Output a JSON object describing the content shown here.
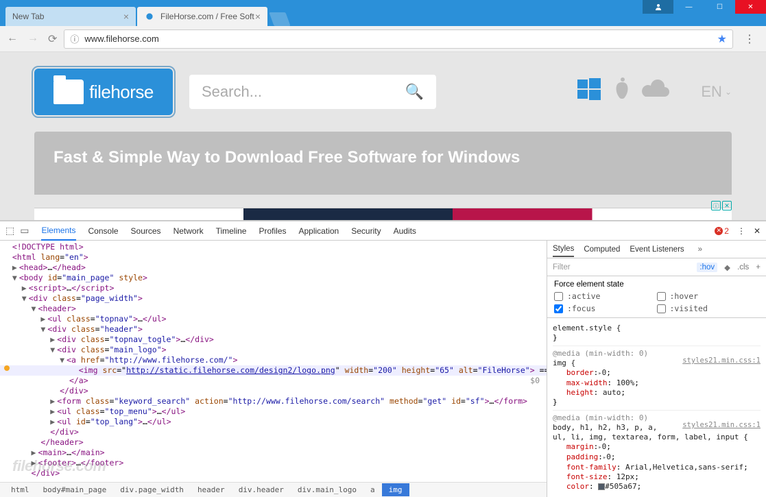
{
  "window": {
    "tabs": [
      {
        "title": "New Tab",
        "active": false
      },
      {
        "title": "FileHorse.com / Free Soft",
        "active": true
      }
    ],
    "address": "www.filehorse.com"
  },
  "page": {
    "logo_text": "filehorse",
    "search_placeholder": "Search...",
    "lang": "EN",
    "hero_title": "Fast & Simple Way to Download Free Software for Windows"
  },
  "devtools": {
    "tabs": [
      "Elements",
      "Console",
      "Sources",
      "Network",
      "Timeline",
      "Profiles",
      "Application",
      "Security",
      "Audits"
    ],
    "active_tab": "Elements",
    "error_count": "2",
    "dom": {
      "l1": "<!DOCTYPE html>",
      "l2_open": "<html ",
      "l2_attr_n": "lang",
      "l2_attr_v": "\"en\"",
      "l2_close": ">",
      "l3": "<head>",
      "l3_ell": "…",
      "l3_end": "</head>",
      "l4_open": "<body ",
      "l4_a1n": "id",
      "l4_a1v": "\"main_page\"",
      "l4_a2n": "style",
      "l4_close": ">",
      "l5": "<script>",
      "l5_ell": "…",
      "l5_end": "</script>",
      "l6_open": "<div ",
      "l6_an": "class",
      "l6_av": "\"page_width\"",
      "l6_close": ">",
      "l7": "<header>",
      "l8_open": "<ul ",
      "l8_an": "class",
      "l8_av": "\"topnav\"",
      "l8_close": ">",
      "l8_ell": "…",
      "l8_end": "</ul>",
      "l9_open": "<div ",
      "l9_an": "class",
      "l9_av": "\"header\"",
      "l9_close": ">",
      "l10_open": "<div ",
      "l10_an": "class",
      "l10_av": "\"topnav_togle\"",
      "l10_close": ">",
      "l10_ell": "…",
      "l10_end": "</div>",
      "l11_open": "<div ",
      "l11_an": "class",
      "l11_av": "\"main_logo\"",
      "l11_close": ">",
      "l12_open": "<a ",
      "l12_an": "href",
      "l12_av": "\"http://www.filehorse.com/\"",
      "l12_close": ">",
      "l13_open": "<img ",
      "l13_a1n": "src",
      "l13_a1v": "http://static.filehorse.com/design2/logo.png",
      "l13_a2n": "width",
      "l13_a2v": "\"200\"",
      "l13_a3n": "height",
      "l13_a3v": "\"65\"",
      "l13_a4n": "alt",
      "l13_a4v": "\"FileHorse\"",
      "l13_close": ">",
      "l13_eq": " ==",
      "l13_dollar": "$0",
      "l14": "</a>",
      "l15": "</div>",
      "l16_open": "<form ",
      "l16_a1n": "class",
      "l16_a1v": "\"keyword_search\"",
      "l16_a2n": "action",
      "l16_a2v": "\"http://www.filehorse.com/search\"",
      "l16_a3n": "method",
      "l16_a3v": "\"get\"",
      "l16_a4n": "id",
      "l16_a4v": "\"sf\"",
      "l16_close": ">",
      "l16_ell": "…",
      "l16_end": "</form>",
      "l17_open": "<ul ",
      "l17_an": "class",
      "l17_av": "\"top_menu\"",
      "l17_close": ">",
      "l17_ell": "…",
      "l17_end": "</ul>",
      "l18_open": "<ul ",
      "l18_an": "id",
      "l18_av": "\"top_lang\"",
      "l18_close": ">",
      "l18_ell": "…",
      "l18_end": "</ul>",
      "l19": "</div>",
      "l20": "</header>",
      "l21": "<main>",
      "l21_ell": "…",
      "l21_end": "</main>",
      "l22": "<footer>",
      "l22_ell": "…",
      "l22_end": "</footer>",
      "l23": "</div>"
    },
    "breadcrumbs": [
      "html",
      "body#main_page",
      "div.page_width",
      "header",
      "div.header",
      "div.main_logo",
      "a",
      "img"
    ],
    "styles": {
      "tabs": [
        "Styles",
        "Computed",
        "Event Listeners"
      ],
      "filter_placeholder": "Filter",
      "hov": ":hov",
      "cls": ".cls",
      "force_label": "Force element state",
      "states": {
        "active": ":active",
        "hover": ":hover",
        "focus": ":focus",
        "visited": ":visited"
      },
      "rule1_sel": "element.style {",
      "rule1_close": "}",
      "rule2_media": "@media (min-width: 0)",
      "rule2_sel": "img {",
      "rule2_src": "styles21.min.css:1",
      "rule2_p1": "border",
      "rule2_v1": "0",
      "rule2_p2": "max-width",
      "rule2_v2": "100%",
      "rule2_p3": "height",
      "rule2_v3": "auto",
      "rule2_close": "}",
      "rule3_media": "@media (min-width: 0)",
      "rule3_sel": "body, h1, h2, h3, p, a,",
      "rule3_sel2": "ul, li, img, textarea, form, label, input {",
      "rule3_src": "styles21.min.css:1",
      "rule3_p1": "margin",
      "rule3_v1": "0",
      "rule3_p2": "padding",
      "rule3_v2": "0",
      "rule3_p3": "font-family",
      "rule3_v3": "Arial,Helvetica,sans-serif",
      "rule3_p4": "font-size",
      "rule3_v4": "12px",
      "rule3_p5": "color",
      "rule3_v5": "#505a67"
    }
  },
  "watermark": "filehorse.com"
}
